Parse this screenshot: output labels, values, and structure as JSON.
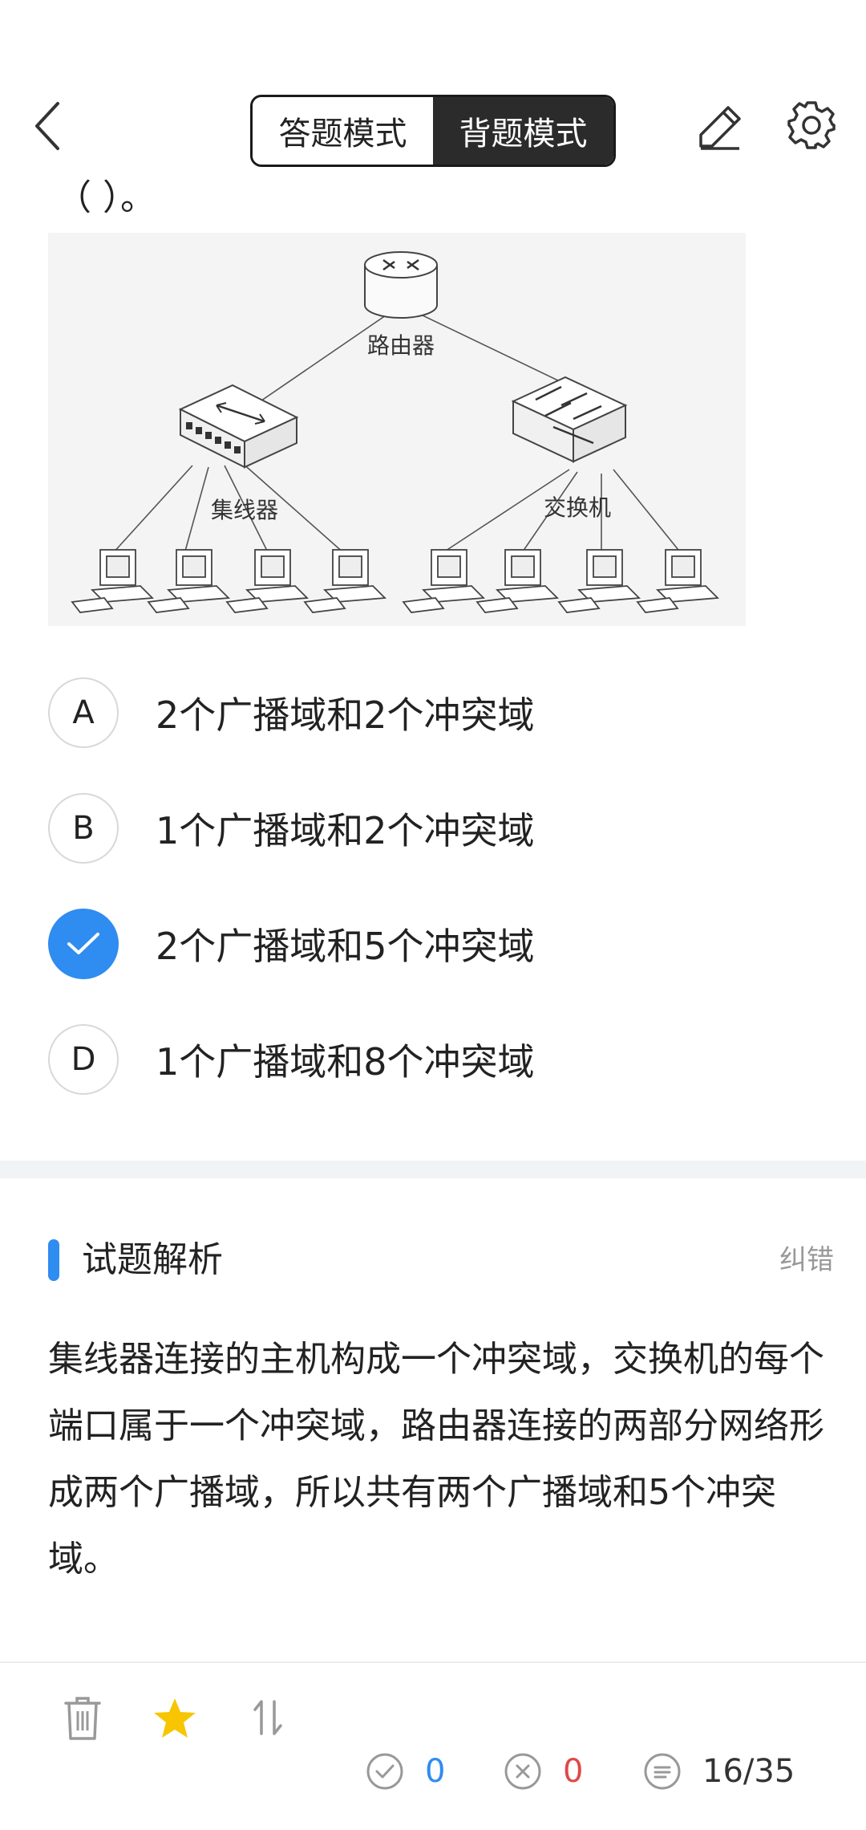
{
  "header": {
    "mode_answer": "答题模式",
    "mode_memorize": "背题模式",
    "active_mode": "mode_memorize"
  },
  "question": {
    "tail_text": "（ ）。"
  },
  "figure": {
    "router_label": "路由器",
    "hub_label": "集线器",
    "switch_label": "交换机"
  },
  "options": [
    {
      "letter": "A",
      "text": "2个广播域和2个冲突域",
      "selected": false
    },
    {
      "letter": "B",
      "text": "1个广播域和2个冲突域",
      "selected": false
    },
    {
      "letter": "C",
      "text": "2个广播域和5个冲突域",
      "selected": true
    },
    {
      "letter": "D",
      "text": "1个广播域和8个冲突域",
      "selected": false
    }
  ],
  "analysis": {
    "title": "试题解析",
    "correction": "纠错",
    "text": "集线器连接的主机构成一个冲突域，交换机的每个端口属于一个冲突域，路由器连接的两部分网络形成两个广播域，所以共有两个广播域和5个冲突域。"
  },
  "bottom": {
    "correct_count": "0",
    "wrong_count": "0",
    "progress": "16/35"
  },
  "colors": {
    "accent": "#2f8cf0",
    "wrong": "#e04848",
    "star": "#f7c600",
    "icon_gray": "#999999"
  }
}
